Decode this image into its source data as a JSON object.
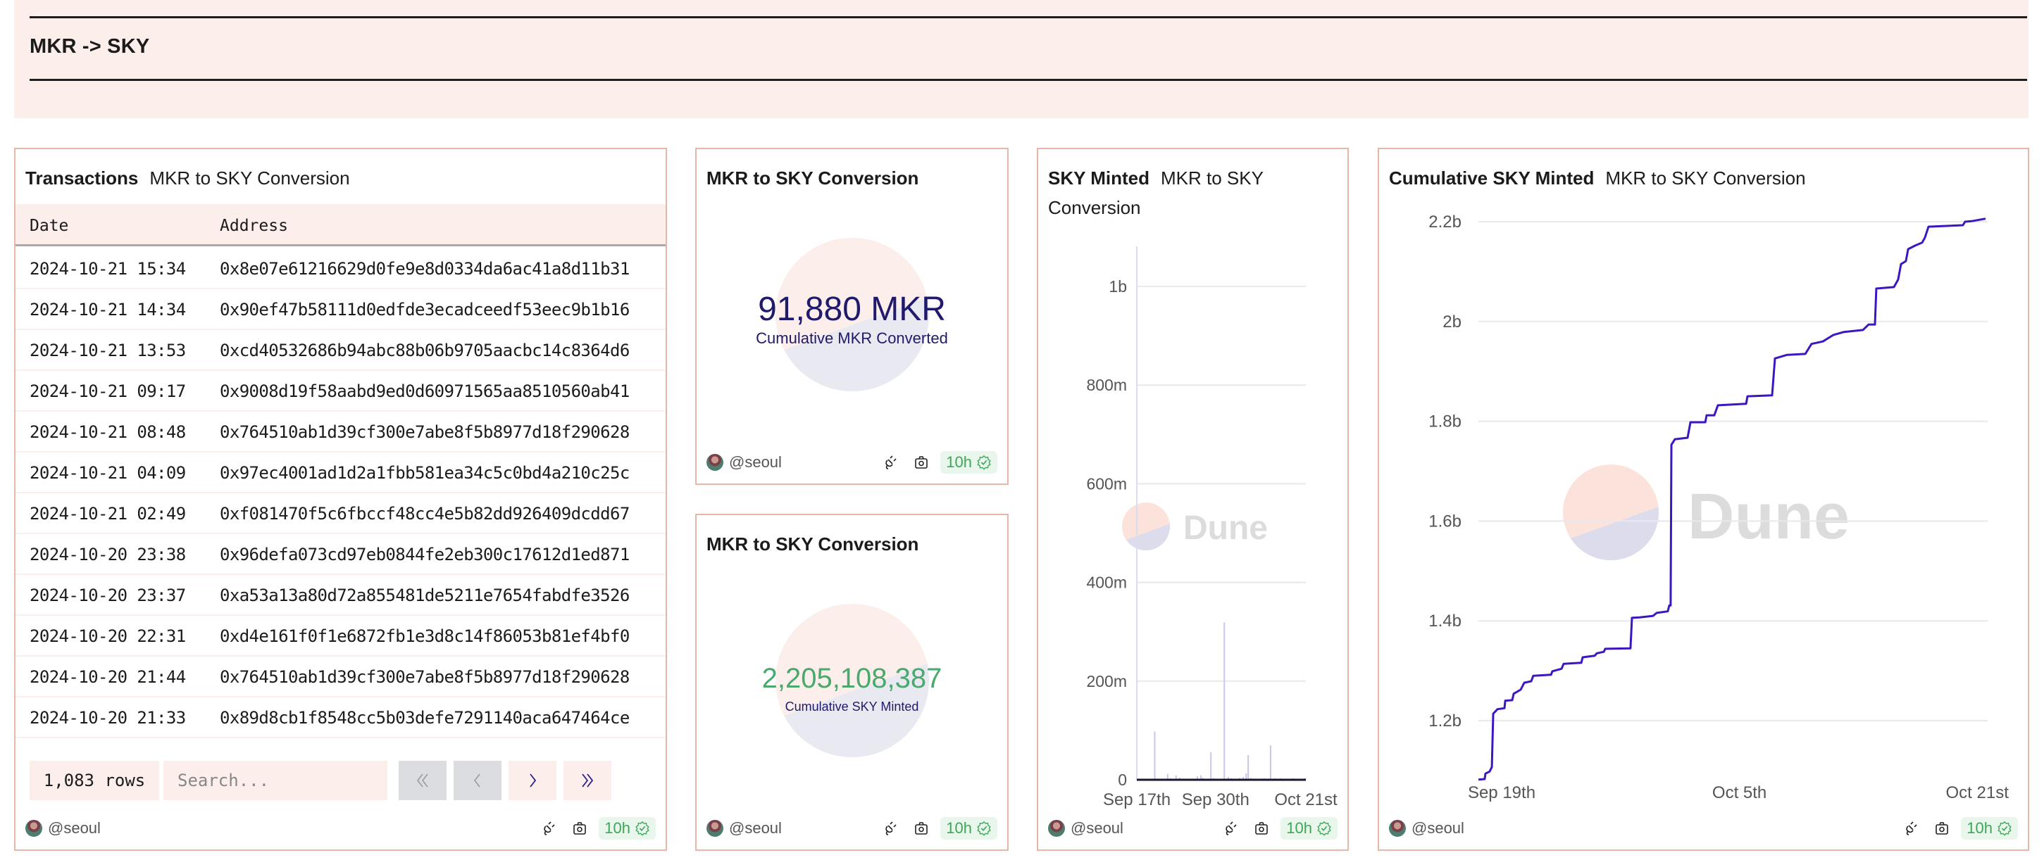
{
  "header": {
    "title": "MKR -> SKY"
  },
  "common": {
    "author": "@seoul",
    "freshness": "10h"
  },
  "table_panel": {
    "title": "Transactions",
    "subtitle": "MKR to SKY Conversion",
    "columns": [
      "Date",
      "Address"
    ],
    "rows": [
      [
        "2024-10-21 15:34",
        "0x8e07e61216629d0fe9e8d0334da6ac41a8d11b31"
      ],
      [
        "2024-10-21 14:34",
        "0x90ef47b58111d0edfde3ecadceedf53eec9b1b16"
      ],
      [
        "2024-10-21 13:53",
        "0xcd40532686b94abc88b06b9705aacbc14c8364d6"
      ],
      [
        "2024-10-21 09:17",
        "0x9008d19f58aabd9ed0d60971565aa8510560ab41"
      ],
      [
        "2024-10-21 08:48",
        "0x764510ab1d39cf300e7abe8f5b8977d18f290628"
      ],
      [
        "2024-10-21 04:09",
        "0x97ec4001ad1d2a1fbb581ea34c5c0bd4a210c25c"
      ],
      [
        "2024-10-21 02:49",
        "0xf081470f5c6fbccf48cc4e5b82dd926409dcdd67"
      ],
      [
        "2024-10-20 23:38",
        "0x96defa073cd97eb0844fe2eb300c17612d1ed871"
      ],
      [
        "2024-10-20 23:37",
        "0xa53a13a80d72a855481de5211e7654fabdfe3526"
      ],
      [
        "2024-10-20 22:31",
        "0xd4e161f0f1e6872fb1e3d8c14f86053b81ef4bf0"
      ],
      [
        "2024-10-20 21:44",
        "0x764510ab1d39cf300e7abe8f5b8977d18f290628"
      ],
      [
        "2024-10-20 21:33",
        "0x89d8cb1f8548cc5b03defe7291140aca647464ce"
      ]
    ],
    "row_count": "1,083 rows",
    "search_placeholder": "Search...",
    "pagination": {
      "first": "«",
      "prev": "‹",
      "next": "›",
      "last": "»",
      "first_enabled": false,
      "prev_enabled": false,
      "next_enabled": true,
      "last_enabled": true
    }
  },
  "counter_mkr": {
    "title": "MKR to SKY Conversion",
    "value": "91,880 MKR",
    "label": "Cumulative MKR Converted",
    "value_color": "#1f1a6b"
  },
  "counter_sky": {
    "title": "MKR to SKY Conversion",
    "value": "2,205,108,387",
    "label": "Cumulative SKY Minted",
    "value_color": "#4aa96c"
  },
  "watermark": {
    "text": "Dune"
  },
  "colors": {
    "border": "#e6b7a9",
    "panel_bg_tint": "#fbeeeb",
    "line": "#3d16c2",
    "bar": "#c9c6ef",
    "green": "#3fa65a"
  },
  "chart_data": [
    {
      "type": "bar",
      "title": "SKY Minted",
      "subtitle": "MKR to SKY Conversion",
      "x_origin": "2024-09-17",
      "x_unit": "days since x_origin",
      "xlim": [
        0,
        34
      ],
      "xticks": [
        {
          "label": "Sep 17th",
          "x": 0
        },
        {
          "label": "Sep 30th",
          "x": 13
        },
        {
          "label": "Oct 21st",
          "x": 34
        }
      ],
      "ylabel": "",
      "xlabel": "",
      "y_unit": "millions",
      "ylim": [
        0,
        1100
      ],
      "yticks": [
        {
          "label": "0",
          "v": 0
        },
        {
          "label": "200m",
          "v": 200
        },
        {
          "label": "400m",
          "v": 400
        },
        {
          "label": "600m",
          "v": 600
        },
        {
          "label": "800m",
          "v": 800
        },
        {
          "label": "1b",
          "v": 1000
        }
      ],
      "grid": true,
      "points": [
        [
          3.6,
          98
        ],
        [
          4.7,
          2
        ],
        [
          6.2,
          12
        ],
        [
          6.8,
          3
        ],
        [
          7.9,
          9
        ],
        [
          8.6,
          4
        ],
        [
          9.3,
          2
        ],
        [
          12.2,
          7
        ],
        [
          12.9,
          9
        ],
        [
          13.3,
          4
        ],
        [
          14.9,
          56
        ],
        [
          15.4,
          3
        ],
        [
          17.6,
          319
        ],
        [
          18.4,
          6
        ],
        [
          19.0,
          3
        ],
        [
          20.7,
          4
        ],
        [
          21.4,
          6
        ],
        [
          22.0,
          13
        ],
        [
          22.4,
          50
        ],
        [
          22.9,
          4
        ],
        [
          24.1,
          2
        ],
        [
          25.6,
          3
        ],
        [
          26.9,
          70
        ],
        [
          27.8,
          3
        ],
        [
          28.9,
          3
        ],
        [
          30.3,
          2
        ],
        [
          31.4,
          3
        ],
        [
          32.3,
          2
        ],
        [
          33.9,
          3
        ]
      ]
    },
    {
      "type": "line",
      "title": "Cumulative SKY Minted",
      "subtitle": "MKR to SKY Conversion",
      "x_origin": "2024-09-19",
      "x_unit": "days since x_origin",
      "xlim": [
        -1.56,
        32.56
      ],
      "xticks": [
        {
          "label": "Sep 19th",
          "x": 0
        },
        {
          "label": "Oct 5th",
          "x": 16
        },
        {
          "label": "Oct 21st",
          "x": 32
        }
      ],
      "y_unit": "billions",
      "ylim": [
        1.08,
        2.21
      ],
      "yticks": [
        {
          "label": "1.2b",
          "v": 1.2
        },
        {
          "label": "1.4b",
          "v": 1.4
        },
        {
          "label": "1.6b",
          "v": 1.6
        },
        {
          "label": "1.8b",
          "v": 1.8
        },
        {
          "label": "2b",
          "v": 2.0
        },
        {
          "label": "2.2b",
          "v": 2.2
        }
      ],
      "grid": true,
      "series": [
        {
          "name": "Cumulative SKY Minted",
          "points": [
            [
              -1.56,
              1.082
            ],
            [
              -1.14,
              1.083
            ],
            [
              -1.09,
              1.094
            ],
            [
              -0.81,
              1.098
            ],
            [
              -0.66,
              1.107
            ],
            [
              -0.57,
              1.214
            ],
            [
              -0.28,
              1.223
            ],
            [
              0.19,
              1.225
            ],
            [
              0.24,
              1.24
            ],
            [
              0.71,
              1.241
            ],
            [
              0.81,
              1.254
            ],
            [
              1.28,
              1.262
            ],
            [
              1.52,
              1.276
            ],
            [
              1.99,
              1.279
            ],
            [
              2.13,
              1.29
            ],
            [
              3.32,
              1.292
            ],
            [
              3.41,
              1.299
            ],
            [
              4.03,
              1.304
            ],
            [
              4.17,
              1.314
            ],
            [
              5.36,
              1.316
            ],
            [
              5.45,
              1.327
            ],
            [
              6.26,
              1.33
            ],
            [
              6.4,
              1.335
            ],
            [
              6.87,
              1.338
            ],
            [
              6.97,
              1.344
            ],
            [
              8.67,
              1.345
            ],
            [
              8.77,
              1.406
            ],
            [
              9.29,
              1.407
            ],
            [
              10.19,
              1.41
            ],
            [
              10.43,
              1.416
            ],
            [
              11.18,
              1.419
            ],
            [
              11.28,
              1.431
            ],
            [
              11.37,
              1.431
            ],
            [
              11.42,
              1.753
            ],
            [
              11.66,
              1.764
            ],
            [
              12.51,
              1.767
            ],
            [
              12.7,
              1.798
            ],
            [
              13.7,
              1.798
            ],
            [
              13.79,
              1.812
            ],
            [
              14.31,
              1.812
            ],
            [
              14.55,
              1.832
            ],
            [
              16.45,
              1.835
            ],
            [
              16.54,
              1.85
            ],
            [
              18.2,
              1.852
            ],
            [
              18.39,
              1.926
            ],
            [
              19.19,
              1.933
            ],
            [
              20.43,
              1.935
            ],
            [
              20.85,
              1.955
            ],
            [
              21.61,
              1.96
            ],
            [
              22.32,
              1.973
            ],
            [
              23.03,
              1.979
            ],
            [
              24.31,
              1.983
            ],
            [
              24.69,
              1.994
            ],
            [
              25.12,
              1.994
            ],
            [
              25.21,
              2.066
            ],
            [
              26.4,
              2.069
            ],
            [
              26.68,
              2.084
            ],
            [
              26.87,
              2.115
            ],
            [
              27.2,
              2.121
            ],
            [
              27.35,
              2.145
            ],
            [
              27.82,
              2.152
            ],
            [
              28.29,
              2.158
            ],
            [
              28.48,
              2.168
            ],
            [
              28.72,
              2.19
            ],
            [
              31.04,
              2.193
            ],
            [
              31.18,
              2.2
            ],
            [
              31.61,
              2.201
            ],
            [
              32.56,
              2.206
            ]
          ]
        }
      ]
    }
  ]
}
